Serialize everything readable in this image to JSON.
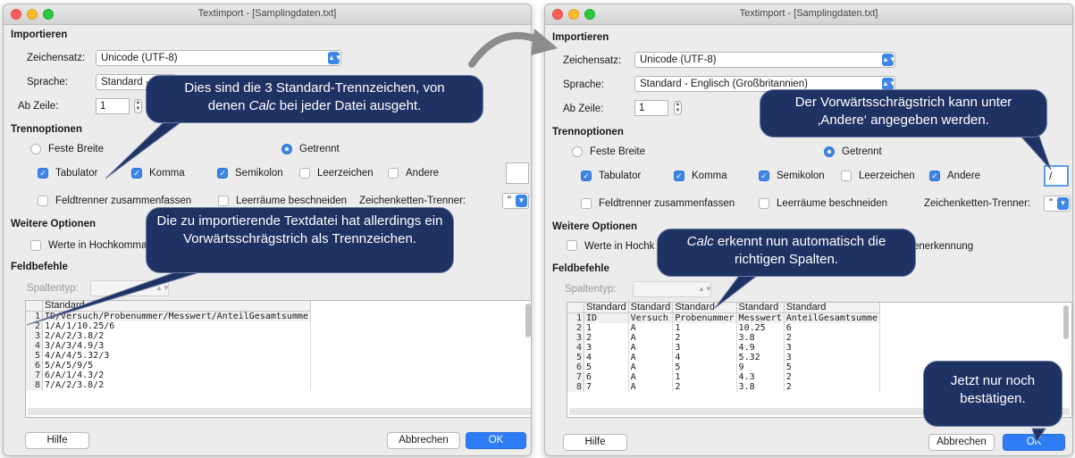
{
  "left_window": {
    "title": "Textimport - [Samplingdaten.txt]",
    "import_heading": "Importieren",
    "charset_label": "Zeichensatz:",
    "charset_value": "Unicode (UTF-8)",
    "language_label": "Sprache:",
    "language_value": "Standard - E",
    "from_row_label": "Ab Zeile:",
    "from_row_value": "1",
    "sep_heading": "Trennoptionen",
    "fixed_width": "Feste Breite",
    "separated": "Getrennt",
    "tab": "Tabulator",
    "comma": "Komma",
    "semicolon": "Semikolon",
    "space": "Leerzeichen",
    "other": "Andere",
    "merge": "Feldtrenner zusammenfassen",
    "trim": "Leerräume beschneiden",
    "string_delim_label": "Zeichenketten-Trenner:",
    "string_delim_value": "\"",
    "more_heading": "Weitere Optionen",
    "quoted_as_text": "Werte in Hochkomma",
    "fields_heading": "Feldbefehle",
    "column_type_label": "Spaltentyp:",
    "grid_header": [
      "Standard"
    ],
    "grid_rows": [
      [
        "1",
        "ID/Versuch/Probenummer/Messwert/AnteilGesamtsumme"
      ],
      [
        "2",
        "1/A/1/10.25/6"
      ],
      [
        "3",
        "2/A/2/3.8/2"
      ],
      [
        "4",
        "3/A/3/4.9/3"
      ],
      [
        "5",
        "4/A/4/5.32/3"
      ],
      [
        "6",
        "5/A/5/9/5"
      ],
      [
        "7",
        "6/A/1/4.3/2"
      ],
      [
        "8",
        "7/A/2/3.8/2"
      ]
    ],
    "help": "Hilfe",
    "cancel": "Abbrechen",
    "ok": "OK"
  },
  "right_window": {
    "title": "Textimport - [Samplingdaten.txt]",
    "import_heading": "Importieren",
    "charset_label": "Zeichensatz:",
    "charset_value": "Unicode (UTF-8)",
    "language_label": "Sprache:",
    "language_value": "Standard - Englisch (Großbritannien)",
    "from_row_label": "Ab Zeile:",
    "from_row_value": "1",
    "sep_heading": "Trennoptionen",
    "fixed_width": "Feste Breite",
    "separated": "Getrennt",
    "tab": "Tabulator",
    "comma": "Komma",
    "semicolon": "Semikolon",
    "space": "Leerzeichen",
    "other": "Andere",
    "other_value": "/",
    "merge": "Feldtrenner zusammenfassen",
    "trim": "Leerräume beschneiden",
    "string_delim_label": "Zeichenketten-Trenner:",
    "string_delim_value": "\"",
    "more_heading": "Weitere Optionen",
    "quoted_as_text": "Werte in Hochk",
    "detection_tail": "enerkennung",
    "fields_heading": "Feldbefehle",
    "column_type_label": "Spaltentyp:",
    "grid_header": [
      "Standard",
      "Standard",
      "Standard",
      "Standard",
      "Standard"
    ],
    "grid_rows": [
      [
        "1",
        "ID",
        "Versuch",
        "Probenummer",
        "Messwert",
        "AnteilGesamtsumme"
      ],
      [
        "2",
        "1",
        "A",
        "1",
        "10.25",
        "6"
      ],
      [
        "3",
        "2",
        "A",
        "2",
        "3.8",
        "2"
      ],
      [
        "4",
        "3",
        "A",
        "3",
        "4.9",
        "3"
      ],
      [
        "5",
        "4",
        "A",
        "4",
        "5.32",
        "3"
      ],
      [
        "6",
        "5",
        "A",
        "5",
        "9",
        "5"
      ],
      [
        "7",
        "6",
        "A",
        "1",
        "4.3",
        "2"
      ],
      [
        "8",
        "7",
        "A",
        "2",
        "3.8",
        "2"
      ]
    ],
    "help": "Hilfe",
    "cancel": "Abbrechen",
    "ok": "OK"
  },
  "callouts": {
    "standard_separators_a": "Dies sind die 3 Standard-Trennzeichen, von",
    "standard_separators_b_pre": "denen ",
    "standard_separators_b_em": "Calc",
    "standard_separators_b_post": " bei jeder Datei ausgeht.",
    "slash_file": "Die zu importierende Textdatei hat allerdings ein Vorwärtsschrägstrich als Trennzeichen.",
    "slash_other": "Der Vorwärtsschrägstrich kann unter ‚Andere‘ angegeben werden.",
    "calc_detects_em": "Calc",
    "calc_detects_rest": " erkennt nun automatisch die richtigen Spalten.",
    "confirm": "Jetzt nur noch bestätigen."
  },
  "colors": {
    "callout_bg": "#1f3264",
    "accent": "#3d86e8",
    "arrow": "#8c8c8c"
  }
}
